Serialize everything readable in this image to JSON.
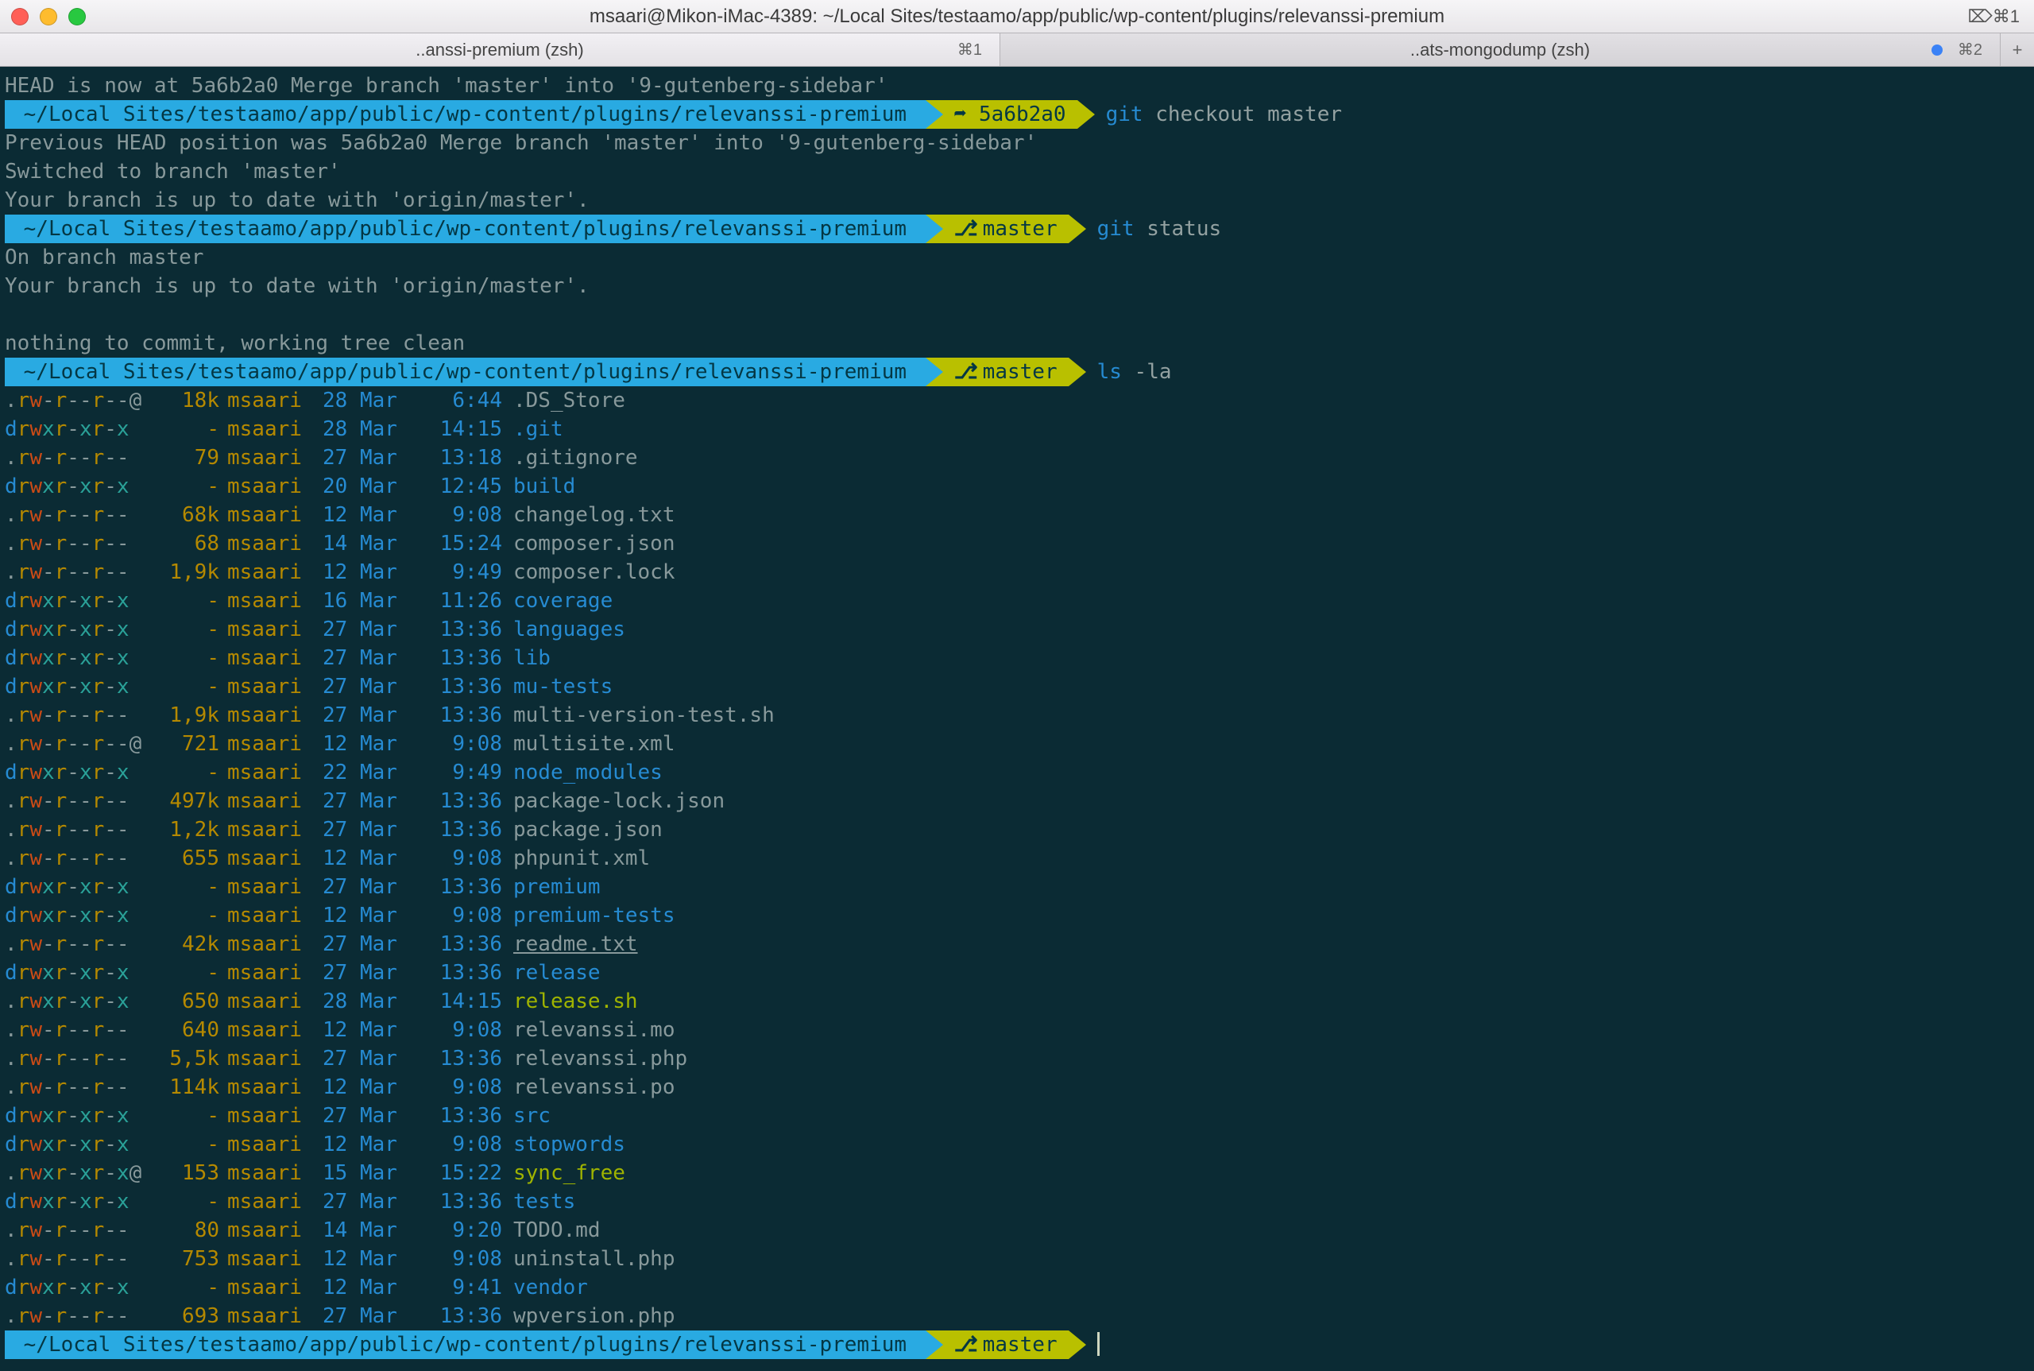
{
  "window": {
    "title": "msaari@Mikon-iMac-4389: ~/Local Sites/testaamo/app/public/wp-content/plugins/relevanssi-premium",
    "shortcut_right": "⌦⌘1"
  },
  "tabs": [
    {
      "label": "..anssi-premium (zsh)",
      "shortcut": "⌘1",
      "active": true,
      "dirty": false
    },
    {
      "label": "..ats-mongodump (zsh)",
      "shortcut": "⌘2",
      "active": false,
      "dirty": true
    }
  ],
  "cwd": "~/Local Sites/testaamo/app/public/wp-content/plugins/relevanssi-premium",
  "sessions": [
    {
      "pre": [
        "HEAD is now at 5a6b2a0 Merge branch 'master' into '9-gutenberg-sidebar'"
      ],
      "head": "5a6b2a0",
      "branch": null,
      "head_icon": "➦",
      "cmd_kw": "git",
      "cmd_rest": " checkout master",
      "out": [
        "Previous HEAD position was 5a6b2a0 Merge branch 'master' into '9-gutenberg-sidebar'",
        "Switched to branch 'master'",
        "Your branch is up to date with 'origin/master'."
      ]
    },
    {
      "pre": [],
      "branch": "master",
      "cmd_kw": "git",
      "cmd_rest": " status",
      "out": [
        "On branch master",
        "Your branch is up to date with 'origin/master'.",
        "",
        "nothing to commit, working tree clean"
      ]
    },
    {
      "pre": [],
      "branch": "master",
      "cmd_kw": "ls",
      "cmd_rest": " -la",
      "out": []
    }
  ],
  "final_prompt_branch": "master",
  "ls": [
    {
      "perm": ".rw-r--r--@",
      "size": "18k",
      "user": "msaari",
      "date": "28 Mar",
      "time": "6:44",
      "name": ".DS_Store",
      "kind": "file"
    },
    {
      "perm": "drwxr-xr-x",
      "size": "-",
      "user": "msaari",
      "date": "28 Mar",
      "time": "14:15",
      "name": ".git",
      "kind": "dir"
    },
    {
      "perm": ".rw-r--r--",
      "size": "79",
      "user": "msaari",
      "date": "27 Mar",
      "time": "13:18",
      "name": ".gitignore",
      "kind": "file"
    },
    {
      "perm": "drwxr-xr-x",
      "size": "-",
      "user": "msaari",
      "date": "20 Mar",
      "time": "12:45",
      "name": "build",
      "kind": "dir"
    },
    {
      "perm": ".rw-r--r--",
      "size": "68k",
      "user": "msaari",
      "date": "12 Mar",
      "time": "9:08",
      "name": "changelog.txt",
      "kind": "file"
    },
    {
      "perm": ".rw-r--r--",
      "size": "68",
      "user": "msaari",
      "date": "14 Mar",
      "time": "15:24",
      "name": "composer.json",
      "kind": "file"
    },
    {
      "perm": ".rw-r--r--",
      "size": "1,9k",
      "user": "msaari",
      "date": "12 Mar",
      "time": "9:49",
      "name": "composer.lock",
      "kind": "file"
    },
    {
      "perm": "drwxr-xr-x",
      "size": "-",
      "user": "msaari",
      "date": "16 Mar",
      "time": "11:26",
      "name": "coverage",
      "kind": "dir"
    },
    {
      "perm": "drwxr-xr-x",
      "size": "-",
      "user": "msaari",
      "date": "27 Mar",
      "time": "13:36",
      "name": "languages",
      "kind": "dir"
    },
    {
      "perm": "drwxr-xr-x",
      "size": "-",
      "user": "msaari",
      "date": "27 Mar",
      "time": "13:36",
      "name": "lib",
      "kind": "dir"
    },
    {
      "perm": "drwxr-xr-x",
      "size": "-",
      "user": "msaari",
      "date": "27 Mar",
      "time": "13:36",
      "name": "mu-tests",
      "kind": "dir"
    },
    {
      "perm": ".rw-r--r--",
      "size": "1,9k",
      "user": "msaari",
      "date": "27 Mar",
      "time": "13:36",
      "name": "multi-version-test.sh",
      "kind": "file"
    },
    {
      "perm": ".rw-r--r--@",
      "size": "721",
      "user": "msaari",
      "date": "12 Mar",
      "time": "9:08",
      "name": "multisite.xml",
      "kind": "file"
    },
    {
      "perm": "drwxr-xr-x",
      "size": "-",
      "user": "msaari",
      "date": "22 Mar",
      "time": "9:49",
      "name": "node_modules",
      "kind": "dir"
    },
    {
      "perm": ".rw-r--r--",
      "size": "497k",
      "user": "msaari",
      "date": "27 Mar",
      "time": "13:36",
      "name": "package-lock.json",
      "kind": "file"
    },
    {
      "perm": ".rw-r--r--",
      "size": "1,2k",
      "user": "msaari",
      "date": "27 Mar",
      "time": "13:36",
      "name": "package.json",
      "kind": "file"
    },
    {
      "perm": ".rw-r--r--",
      "size": "655",
      "user": "msaari",
      "date": "12 Mar",
      "time": "9:08",
      "name": "phpunit.xml",
      "kind": "file"
    },
    {
      "perm": "drwxr-xr-x",
      "size": "-",
      "user": "msaari",
      "date": "27 Mar",
      "time": "13:36",
      "name": "premium",
      "kind": "dir"
    },
    {
      "perm": "drwxr-xr-x",
      "size": "-",
      "user": "msaari",
      "date": "12 Mar",
      "time": "9:08",
      "name": "premium-tests",
      "kind": "dir"
    },
    {
      "perm": ".rw-r--r--",
      "size": "42k",
      "user": "msaari",
      "date": "27 Mar",
      "time": "13:36",
      "name": "readme.txt",
      "kind": "file",
      "ul": true
    },
    {
      "perm": "drwxr-xr-x",
      "size": "-",
      "user": "msaari",
      "date": "27 Mar",
      "time": "13:36",
      "name": "release",
      "kind": "dir"
    },
    {
      "perm": ".rwxr-xr-x",
      "size": "650",
      "user": "msaari",
      "date": "28 Mar",
      "time": "14:15",
      "name": "release.sh",
      "kind": "exec"
    },
    {
      "perm": ".rw-r--r--",
      "size": "640",
      "user": "msaari",
      "date": "12 Mar",
      "time": "9:08",
      "name": "relevanssi.mo",
      "kind": "file"
    },
    {
      "perm": ".rw-r--r--",
      "size": "5,5k",
      "user": "msaari",
      "date": "27 Mar",
      "time": "13:36",
      "name": "relevanssi.php",
      "kind": "file"
    },
    {
      "perm": ".rw-r--r--",
      "size": "114k",
      "user": "msaari",
      "date": "12 Mar",
      "time": "9:08",
      "name": "relevanssi.po",
      "kind": "file"
    },
    {
      "perm": "drwxr-xr-x",
      "size": "-",
      "user": "msaari",
      "date": "27 Mar",
      "time": "13:36",
      "name": "src",
      "kind": "dir"
    },
    {
      "perm": "drwxr-xr-x",
      "size": "-",
      "user": "msaari",
      "date": "12 Mar",
      "time": "9:08",
      "name": "stopwords",
      "kind": "dir"
    },
    {
      "perm": ".rwxr-xr-x@",
      "size": "153",
      "user": "msaari",
      "date": "15 Mar",
      "time": "15:22",
      "name": "sync_free",
      "kind": "exec"
    },
    {
      "perm": "drwxr-xr-x",
      "size": "-",
      "user": "msaari",
      "date": "27 Mar",
      "time": "13:36",
      "name": "tests",
      "kind": "dir"
    },
    {
      "perm": ".rw-r--r--",
      "size": "80",
      "user": "msaari",
      "date": "14 Mar",
      "time": "9:20",
      "name": "TODO.md",
      "kind": "file"
    },
    {
      "perm": ".rw-r--r--",
      "size": "753",
      "user": "msaari",
      "date": "12 Mar",
      "time": "9:08",
      "name": "uninstall.php",
      "kind": "file"
    },
    {
      "perm": "drwxr-xr-x",
      "size": "-",
      "user": "msaari",
      "date": "12 Mar",
      "time": "9:41",
      "name": "vendor",
      "kind": "dir"
    },
    {
      "perm": ".rw-r--r--",
      "size": "693",
      "user": "msaari",
      "date": "27 Mar",
      "time": "13:36",
      "name": "wpversion.php",
      "kind": "file"
    }
  ]
}
